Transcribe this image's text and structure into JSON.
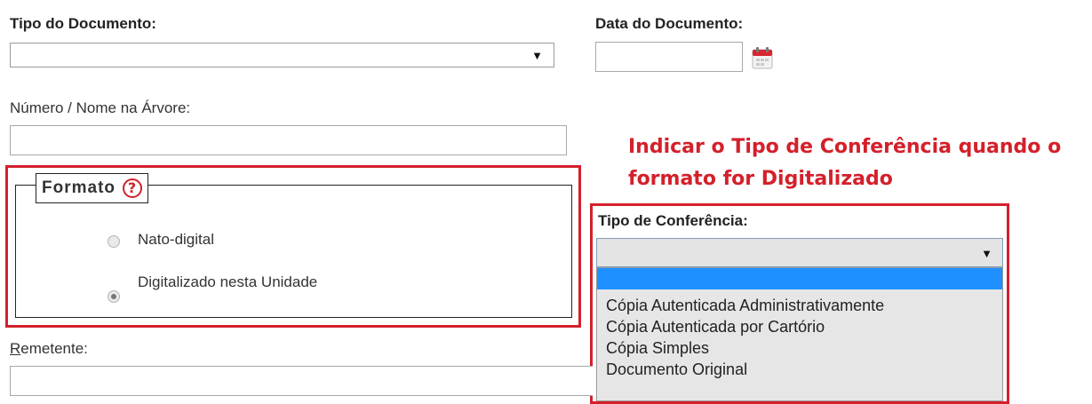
{
  "form": {
    "tipo_documento": {
      "label": "Tipo do Documento:",
      "value": ""
    },
    "data_documento": {
      "label": "Data do Documento:",
      "value": ""
    },
    "numero_nome": {
      "label": "Número / Nome na Árvore:",
      "value": ""
    },
    "formato": {
      "legend": "Formato",
      "help": "?",
      "options": [
        {
          "label": "Nato-digital",
          "checked": false
        },
        {
          "label": "Digitalizado nesta Unidade",
          "checked": true
        }
      ]
    },
    "tipo_conferencia": {
      "label": "Tipo de Conferência:",
      "selected": "",
      "options": [
        "",
        "Cópia Autenticada Administrativamente",
        "Cópia Autenticada por Cartório",
        "Cópia Simples",
        "Documento Original"
      ]
    },
    "remetente": {
      "label_first": "R",
      "label_rest": "emetente:",
      "value": ""
    }
  },
  "annotation": {
    "line1": "Indicar o Tipo de Conferência quando o",
    "line2": "formato for Digitalizado"
  },
  "icons": {
    "select_arrow": "▼",
    "calendar": "calendar-icon"
  },
  "colors": {
    "annotation_red": "#d4202b",
    "selected_option": "#1e90ff",
    "dropdown_bg": "#e6e6e6"
  }
}
